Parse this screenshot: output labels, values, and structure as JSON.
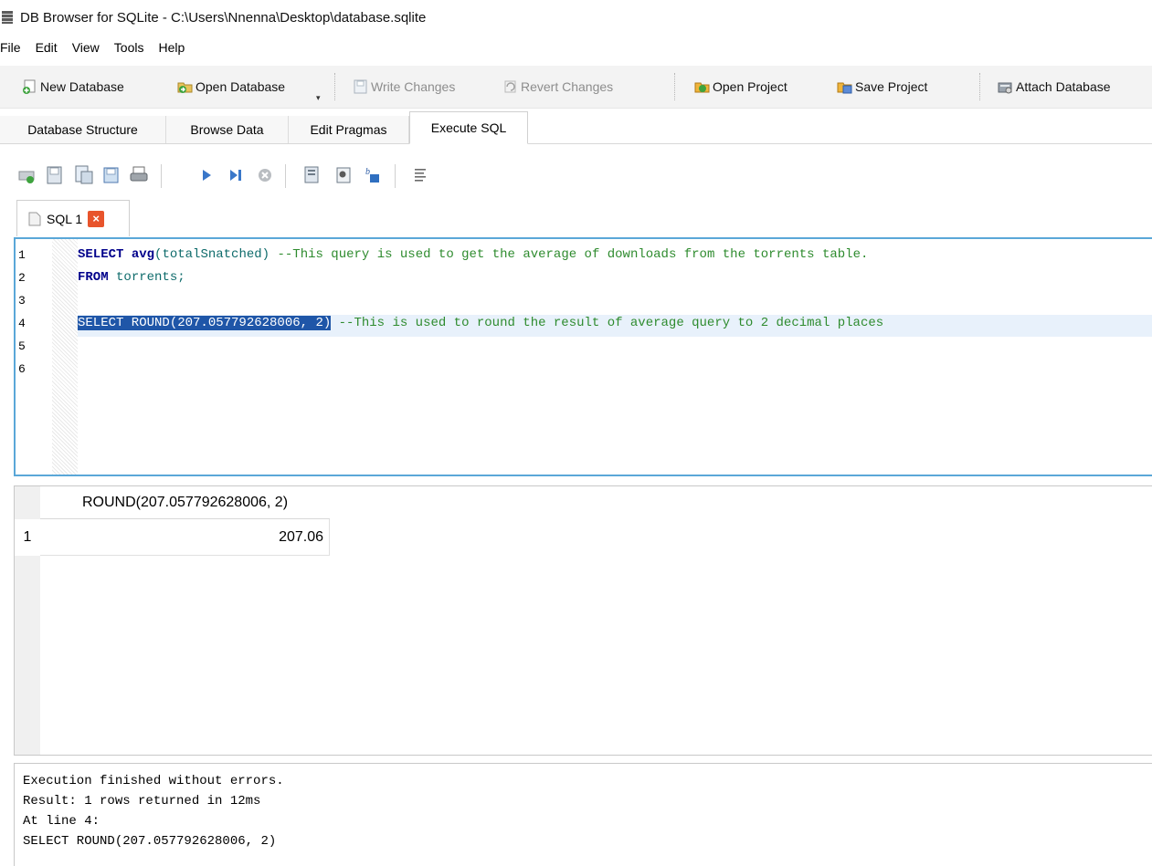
{
  "window": {
    "title": "DB Browser for SQLite - C:\\Users\\Nnenna\\Desktop\\database.sqlite",
    "icon": "database-app-icon"
  },
  "menu": [
    "File",
    "Edit",
    "View",
    "Tools",
    "Help"
  ],
  "main_toolbar": {
    "new_database": "New Database",
    "open_database": "Open Database",
    "write_changes": "Write Changes",
    "revert_changes": "Revert Changes",
    "open_project": "Open Project",
    "save_project": "Save Project",
    "attach_database": "Attach Database"
  },
  "tabs": [
    {
      "label": "Database Structure",
      "active": false
    },
    {
      "label": "Browse Data",
      "active": false
    },
    {
      "label": "Edit Pragmas",
      "active": false
    },
    {
      "label": "Execute SQL",
      "active": true
    }
  ],
  "execute_toolbar_icons": [
    "open-tab-icon",
    "open-sql-file-icon",
    "save-sql-file-icon",
    "print-icon",
    "execute-all-icon",
    "execute-current-line-icon",
    "stop-execution-icon",
    "save-results-icon",
    "find-icon",
    "find-replace-icon",
    "comment-block-icon"
  ],
  "sql_tab": {
    "label": "SQL 1"
  },
  "editor": {
    "line_numbers": [
      "1",
      "2",
      "3",
      "4",
      "5",
      "6"
    ],
    "line1": {
      "kw1": "SELECT",
      "fn": "avg",
      "args": "(totalSnatched)",
      "comment": "--This query is used to get the average of downloads from the torrents table."
    },
    "line2": {
      "kw": "FROM",
      "table": "torrents;"
    },
    "line4": {
      "selected": "SELECT ROUND(207.057792628006, 2)",
      "comment": "--This is used to round the result of average query to 2 decimal places"
    }
  },
  "results": {
    "columns": [
      "ROUND(207.057792628006, 2)"
    ],
    "rows": [
      {
        "num": "1",
        "values": [
          "207.06"
        ]
      }
    ]
  },
  "message": {
    "line1": "Execution finished without errors.",
    "line2": "Result: 1 rows returned in 12ms",
    "line3": "At line 4:",
    "line4": "SELECT ROUND(207.057792628006, 2)"
  }
}
